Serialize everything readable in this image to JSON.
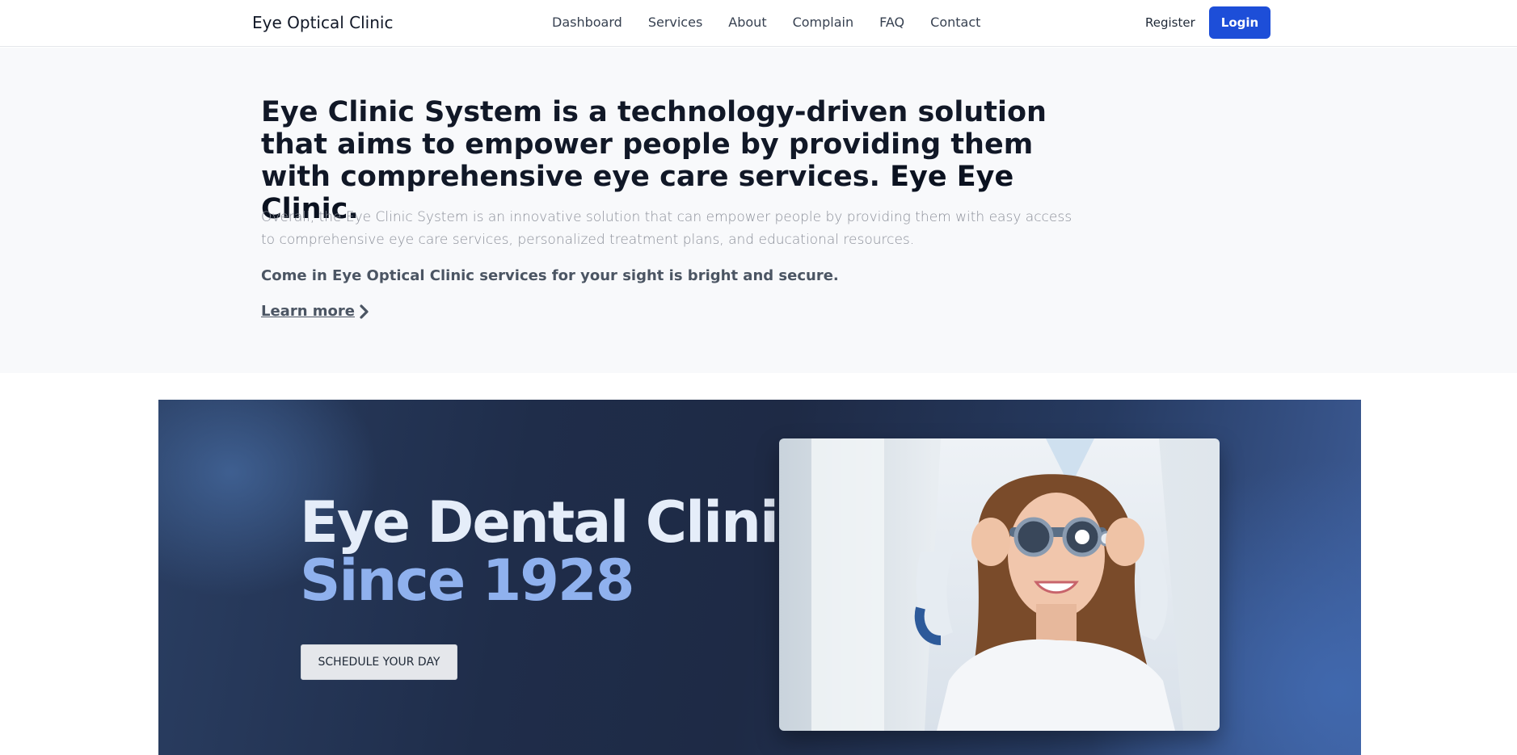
{
  "header": {
    "brand": "Eye Optical Clinic",
    "nav": [
      "Dashboard",
      "Services",
      "About",
      "Complain",
      "FAQ",
      "Contact"
    ],
    "register_label": "Register",
    "login_label": "Login"
  },
  "hero": {
    "headline": "Eye Clinic System is a technology-driven solution that aims to empower people by providing them with comprehensive eye care services. ",
    "headline_accent": "Eye Eye Clinic",
    "headline_end": ".",
    "description": "Overall, the Eye Clinic System is an innovative solution that can empower people by providing them with easy access to comprehensive eye care services, personalized treatment plans, and educational resources.",
    "tagline": "Come in Eye Optical Clinic services for your sight is bright and secure.",
    "learn_more": "Learn more",
    "learn_more_icon": "chevron-right-icon"
  },
  "banner": {
    "title_line1": "Eye Dental Clinic",
    "title_line2": "Since 1928",
    "schedule_label": "SCHEDULE YOUR DAY",
    "photo_subject": "patient-with-trial-frame-photo",
    "colors": {
      "title": "#e5edf9",
      "accent": "#8fb1ee",
      "login": "#1d4ed8"
    }
  }
}
